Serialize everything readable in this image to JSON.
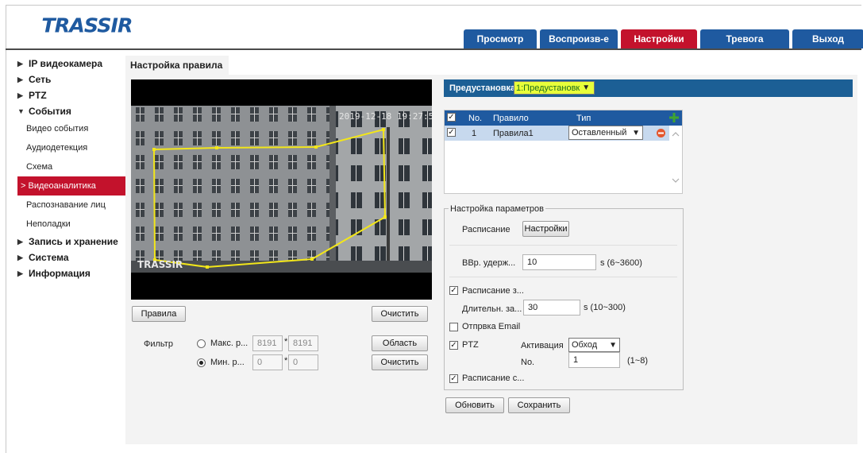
{
  "brand": {
    "logo_text": "TRASSIR"
  },
  "nav": {
    "tabs": [
      {
        "label": "Просмотр",
        "active": false
      },
      {
        "label": "Воспроизв-е",
        "active": false
      },
      {
        "label": "Настройки",
        "active": true
      },
      {
        "label": "Тревога",
        "active": false
      },
      {
        "label": "Выход",
        "active": false
      }
    ]
  },
  "sidebar": {
    "sections": [
      {
        "label": "IP видеокамера",
        "expanded": false
      },
      {
        "label": "Сеть",
        "expanded": false
      },
      {
        "label": "PTZ",
        "expanded": false
      },
      {
        "label": "События",
        "expanded": true
      },
      {
        "label": "Запись и хранение",
        "expanded": false
      },
      {
        "label": "Система",
        "expanded": false
      },
      {
        "label": "Информация",
        "expanded": false
      }
    ],
    "event_items": [
      {
        "label": "Видео события"
      },
      {
        "label": "Аудиодетекция"
      },
      {
        "label": "Схема"
      },
      {
        "label": "Видеоаналитика",
        "active": true
      },
      {
        "label": "Распознавание лиц"
      },
      {
        "label": "Неполадки"
      }
    ],
    "active_marker": ">"
  },
  "content": {
    "tab_title": "Настройка правила",
    "video": {
      "timestamp": "2019-12-18 19:27:50",
      "watermark": "TRASSIR"
    },
    "buttons": {
      "rules": "Правила",
      "clear_top": "Очистить",
      "area": "Область",
      "clear_bottom": "Очистить"
    },
    "filter": {
      "label": "Фильтр",
      "max_label": "Макс. р...",
      "max_w": "8191",
      "max_h": "8191",
      "min_label": "Мин. р...",
      "min_w": "0",
      "min_h": "0",
      "times": "*",
      "selected": "min"
    }
  },
  "preset": {
    "label": "Предустановка",
    "value": "1:Предустановк"
  },
  "rules_table": {
    "columns": [
      "No.",
      "Правило",
      "Тип"
    ],
    "rows": [
      {
        "no": "1",
        "name": "Правила1",
        "type": "Оставленный"
      }
    ]
  },
  "params": {
    "legend": "Настройка параметров",
    "schedule_label": "Расписание",
    "schedule_button": "Настройки",
    "hold_label": "BBр. удерж...",
    "hold_value": "10",
    "hold_range": "s (6~3600)",
    "schedule_rec_label": "Расписание з...",
    "schedule_rec_checked": true,
    "duration_label": "Длительн. за...",
    "duration_value": "30",
    "duration_range": "s (10~300)",
    "email_label": "Отпрвка Email",
    "email_checked": false,
    "ptz_label": "PTZ",
    "ptz_checked": true,
    "activation_label": "Активация",
    "activation_value": "Обход",
    "no_label": "No.",
    "no_value": "1",
    "no_range": "(1~8)",
    "schedule_snap_label": "Расписание с...",
    "schedule_snap_checked": true
  },
  "footer_buttons": {
    "update": "Обновить",
    "save": "Сохранить"
  },
  "colors": {
    "nav_blue": "#1f5aa0",
    "nav_active_red": "#c3122c",
    "preset_bar": "#1c5f95",
    "preset_select_bg": "#e8ff3a",
    "rule_highlight": "#c7d9ee",
    "polygon_yellow": "#f2e61a"
  }
}
